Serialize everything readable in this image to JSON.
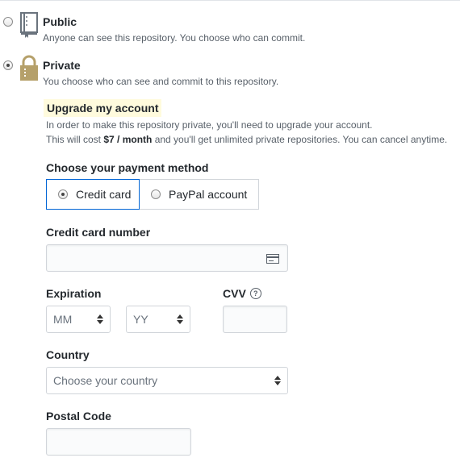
{
  "visibility": {
    "public": {
      "title": "Public",
      "note": "Anyone can see this repository. You choose who can commit."
    },
    "private": {
      "title": "Private",
      "note": "You choose who can see and commit to this repository."
    }
  },
  "upgrade": {
    "title": "Upgrade my account",
    "line1": "In order to make this repository private, you'll need to upgrade your account.",
    "line2_prefix": "This will cost ",
    "price": "$7 / month",
    "line2_suffix": " and you'll get unlimited private repositories. You can cancel anytime."
  },
  "payment": {
    "heading": "Choose your payment method",
    "credit_card": "Credit card",
    "paypal": "PayPal account"
  },
  "card": {
    "number_label": "Credit card number",
    "expiration_label": "Expiration",
    "month_placeholder": "MM",
    "year_placeholder": "YY",
    "cvv_label": "CVV",
    "cvv_help": "?"
  },
  "country": {
    "label": "Country",
    "placeholder": "Choose your country"
  },
  "postal": {
    "label": "Postal Code"
  },
  "colors": {
    "accent_border": "#0366d6",
    "highlight": "#fffbdd",
    "book_icon": "#6a737d",
    "lock_icon": "#b5a06a"
  },
  "icons": [
    "book-icon",
    "lock-icon",
    "credit-card-icon",
    "question-icon"
  ]
}
